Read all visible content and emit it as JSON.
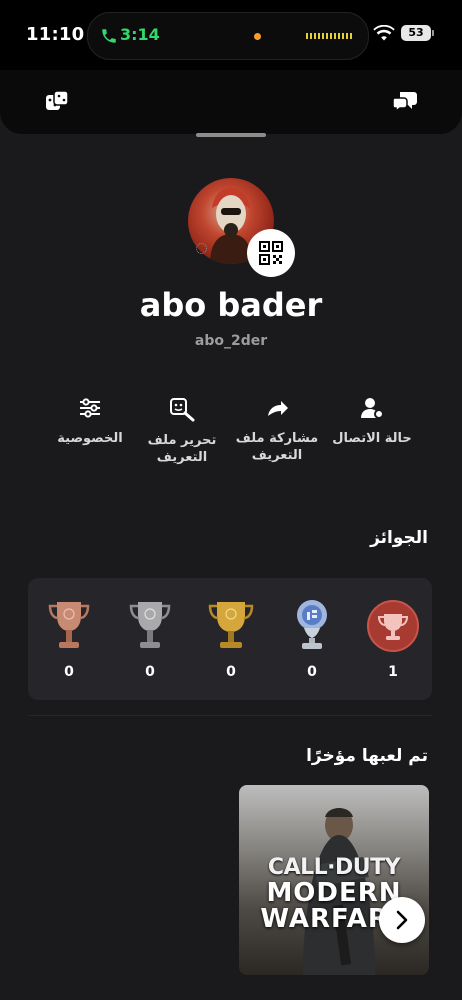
{
  "status_bar": {
    "time": "11:10",
    "call_time": "3:14",
    "battery": "53"
  },
  "header": {
    "left_icon": "gamepad-icon",
    "right_icon": "chat-bubbles-icon"
  },
  "profile": {
    "display_name": "abo bader",
    "username": "abo_2der"
  },
  "actions": [
    {
      "icon": "person-status-icon",
      "label": "حالة الاتصال"
    },
    {
      "icon": "share-arrow-icon",
      "label": "مشاركة ملف التعريف"
    },
    {
      "icon": "edit-profile-icon",
      "label": "تحرير ملف التعريف"
    },
    {
      "icon": "sliders-icon",
      "label": "الخصوصية"
    }
  ],
  "trophies": {
    "title": "الجوائز",
    "items": [
      {
        "type": "platinum-badge",
        "count": "1"
      },
      {
        "type": "platinum",
        "count": "0"
      },
      {
        "type": "gold",
        "count": "0"
      },
      {
        "type": "silver",
        "count": "0"
      },
      {
        "type": "bronze",
        "count": "0"
      }
    ]
  },
  "recently_played": {
    "title": "تم لعبها مؤخرًا",
    "games": [
      {
        "title_line1": "CALL·DUTY",
        "title_line2": "MODERN WARFARE"
      }
    ]
  },
  "colors": {
    "background": "#1a1a1c",
    "card": "#26262a",
    "call_green": "#35d66b"
  }
}
